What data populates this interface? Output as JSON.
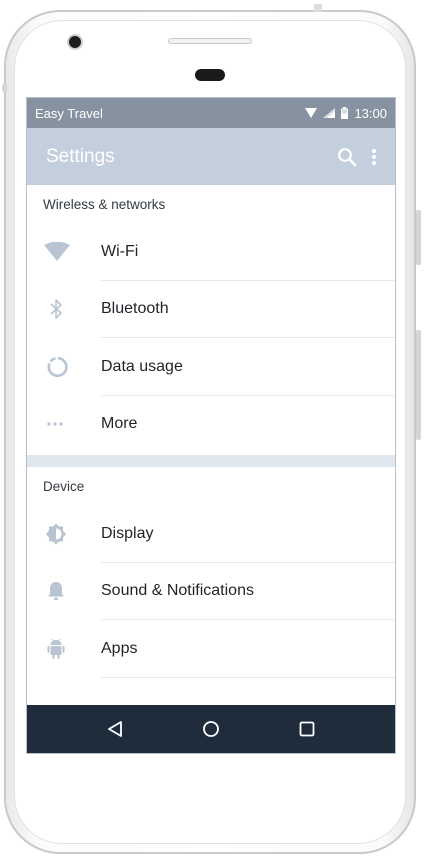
{
  "status_bar": {
    "carrier": "Easy Travel",
    "time": "13:00"
  },
  "app_bar": {
    "title": "Settings",
    "search_icon": "search-icon",
    "more_icon": "more-vert-icon"
  },
  "sections": [
    {
      "header": "Wireless & networks",
      "items": [
        {
          "label": "Wi-Fi",
          "icon": "wifi-icon"
        },
        {
          "label": "Bluetooth",
          "icon": "bluetooth-icon"
        },
        {
          "label": "Data usage",
          "icon": "data-usage-icon"
        },
        {
          "label": "More",
          "icon": "more-horiz-icon"
        }
      ]
    },
    {
      "header": "Device",
      "items": [
        {
          "label": "Display",
          "icon": "brightness-icon"
        },
        {
          "label": "Sound & Notifications",
          "icon": "bell-icon"
        },
        {
          "label": "Apps",
          "icon": "android-icon"
        }
      ]
    }
  ],
  "nav_bar": {
    "back_icon": "back-icon",
    "home_icon": "home-icon",
    "recents_icon": "recents-icon"
  },
  "colors": {
    "status_bar": "#8692a0",
    "app_bar": "#c3cfdd",
    "nav_bar": "#1f2c3c",
    "section_gap": "#dfe6ee",
    "icon": "#b8c4d2"
  }
}
